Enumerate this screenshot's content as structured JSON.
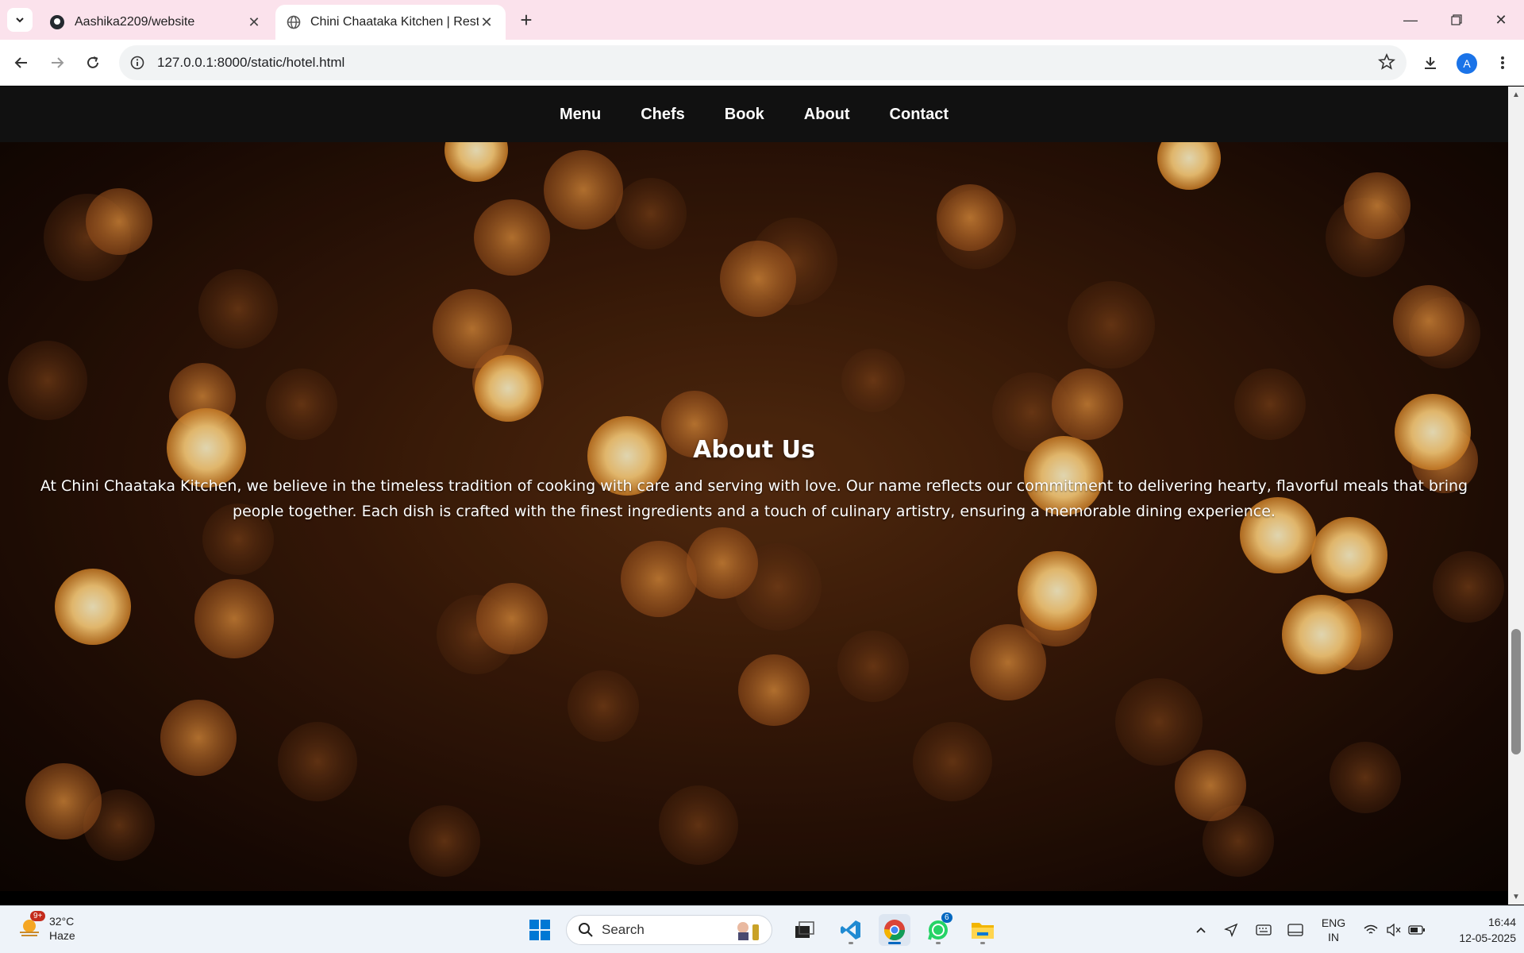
{
  "browser": {
    "tabs": [
      {
        "title": "Aashika2209/website",
        "icon": "github-icon"
      },
      {
        "title": "Chini Chaataka Kitchen | Restau",
        "icon": "globe-icon"
      }
    ],
    "url": "127.0.0.1:8000/static/hotel.html",
    "profile_initial": "A"
  },
  "site": {
    "nav": [
      "Menu",
      "Chefs",
      "Book",
      "About",
      "Contact"
    ],
    "about": {
      "title": "About Us",
      "text": "At Chini Chaataka Kitchen, we believe in the timeless tradition of cooking with care and serving with love. Our name reflects our commitment to delivering hearty, flavorful meals that bring people together. Each dish is crafted with the finest ingredients and a touch of culinary artistry, ensuring a memorable dining experience."
    }
  },
  "taskbar": {
    "weather": {
      "temp": "32°C",
      "condition": "Haze",
      "badge": "9+"
    },
    "search_label": "Search",
    "whatsapp_badge": "6",
    "language": {
      "line1": "ENG",
      "line2": "IN"
    },
    "time": "16:44",
    "date": "12-05-2025"
  },
  "colors": {
    "tabbar": "#fbe2ec",
    "site_nav": "#111111",
    "accent": "#0067c0"
  }
}
